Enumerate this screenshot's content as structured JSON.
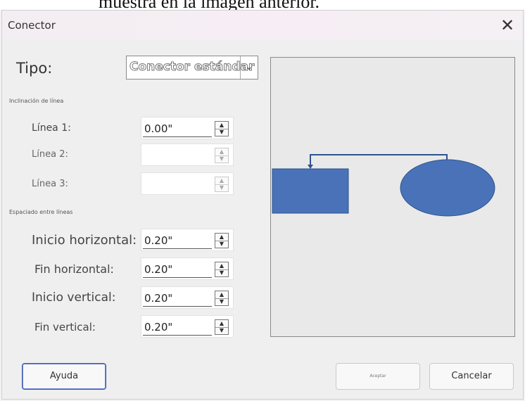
{
  "doc_text": "muestra en la imagen anterior.",
  "dialog": {
    "title": "Conector",
    "close_glyph": "✕",
    "tipo_label": "Tipo:",
    "tipo_value": "Conector estándar",
    "tipo_arrow": "⌄",
    "section_inclination": "Inclinación de línea",
    "lines": [
      {
        "label": "Línea 1:",
        "value": "0.00\""
      },
      {
        "label": "Línea 2:",
        "value": ""
      },
      {
        "label": "Línea 3:",
        "value": ""
      }
    ],
    "section_spacing": "Espaciado entre líneas",
    "spacing": [
      {
        "label": "Inicio horizontal:",
        "value": "0.20\""
      },
      {
        "label": "Fin horizontal:",
        "value": "0.20\""
      },
      {
        "label": "Inicio vertical:",
        "value": "0.20\""
      },
      {
        "label": "Fin vertical:",
        "value": "0.20\""
      }
    ],
    "spin_up": "▲",
    "spin_down": "▼",
    "help_button": "Ayuda",
    "ok_button": "Aceptar",
    "cancel_button": "Cancelar"
  },
  "colors": {
    "shape_fill": "#4a72b8",
    "shape_stroke": "#2f528f",
    "connector": "#2f528f"
  },
  "icons": {
    "close": "close-icon",
    "dropdown": "chevron-down-icon",
    "spin_up": "spin-up-icon",
    "spin_down": "spin-down-icon"
  }
}
